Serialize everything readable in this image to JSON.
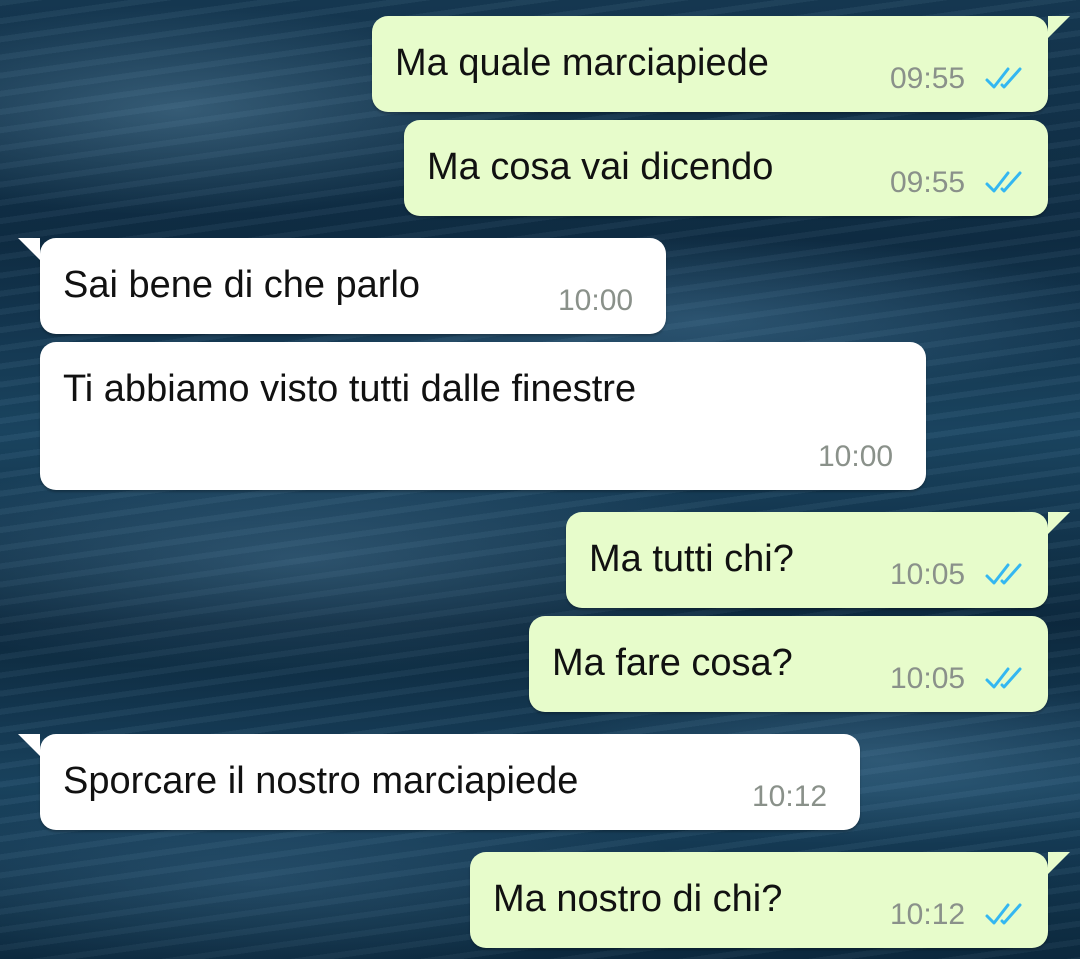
{
  "chat": {
    "messages": [
      {
        "direction": "out",
        "text": "Ma quale marciapiede",
        "time": "09:55",
        "status": "read-double-check"
      },
      {
        "direction": "out",
        "text": "Ma cosa vai dicendo",
        "time": "09:55",
        "status": "read-double-check"
      },
      {
        "direction": "in",
        "text": "Sai bene di che parlo",
        "time": "10:00"
      },
      {
        "direction": "in",
        "text": "Ti abbiamo visto tutti dalle finestre",
        "time": "10:00"
      },
      {
        "direction": "out",
        "text": "Ma tutti chi?",
        "time": "10:05",
        "status": "read-double-check"
      },
      {
        "direction": "out",
        "text": "Ma fare cosa?",
        "time": "10:05",
        "status": "read-double-check"
      },
      {
        "direction": "in",
        "text": "Sporcare il nostro marciapiede",
        "time": "10:12"
      },
      {
        "direction": "out",
        "text": "Ma nostro di chi?",
        "time": "10:12",
        "status": "read-double-check"
      }
    ]
  },
  "colors": {
    "outgoing_bubble": "#e7fccb",
    "incoming_bubble": "#ffffff",
    "read_check": "#34b7f1",
    "timestamp": "#8a918a"
  },
  "icons": {
    "wallpaper": "ocean-waves-wallpaper",
    "read_receipt": "double-check-icon"
  }
}
